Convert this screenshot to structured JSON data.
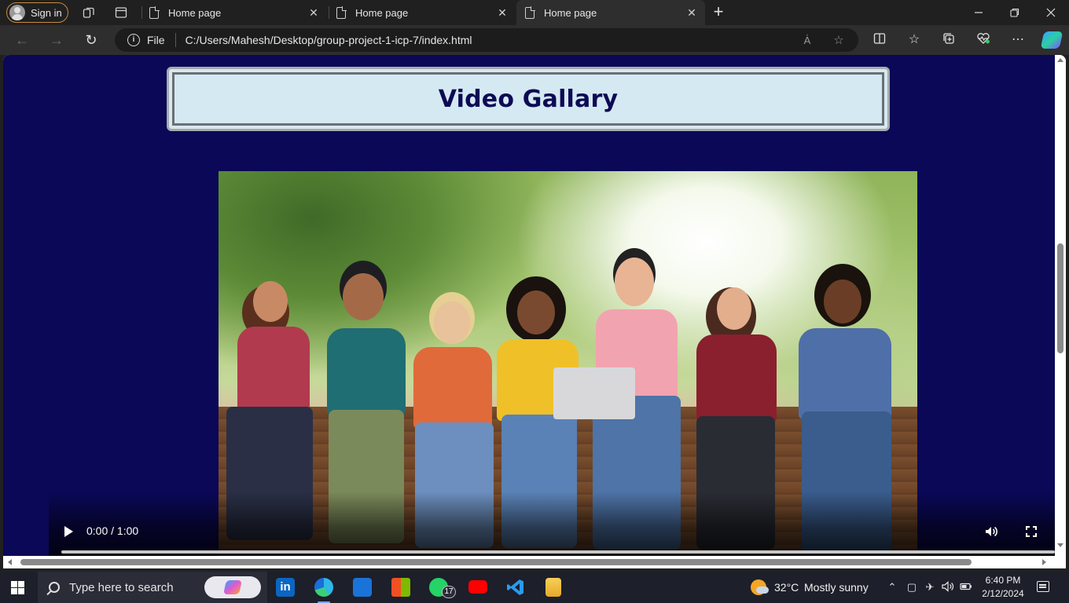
{
  "browser": {
    "signin_label": "Sign in",
    "tabs": [
      {
        "label": "Home page",
        "active": false
      },
      {
        "label": "Home page",
        "active": false
      },
      {
        "label": "Home page",
        "active": true
      }
    ],
    "address": {
      "scheme_label": "File",
      "url": "C:/Users/Mahesh/Desktop/group-project-1-icp-7/index.html"
    }
  },
  "page": {
    "title": "Video Gallary",
    "video": {
      "timecode": "0:00 / 1:00"
    }
  },
  "taskbar": {
    "search_placeholder": "Type here to search",
    "whatsapp_badge": "17",
    "weather": {
      "temp": "32°C",
      "condition": "Mostly sunny"
    },
    "clock": {
      "time": "6:40 PM",
      "date": "2/12/2024"
    }
  },
  "colors": {
    "page_background": "#0a0857",
    "heading_background": "#d4e9f1",
    "heading_text": "#0d0a55",
    "signin_border": "#c98a3c"
  }
}
